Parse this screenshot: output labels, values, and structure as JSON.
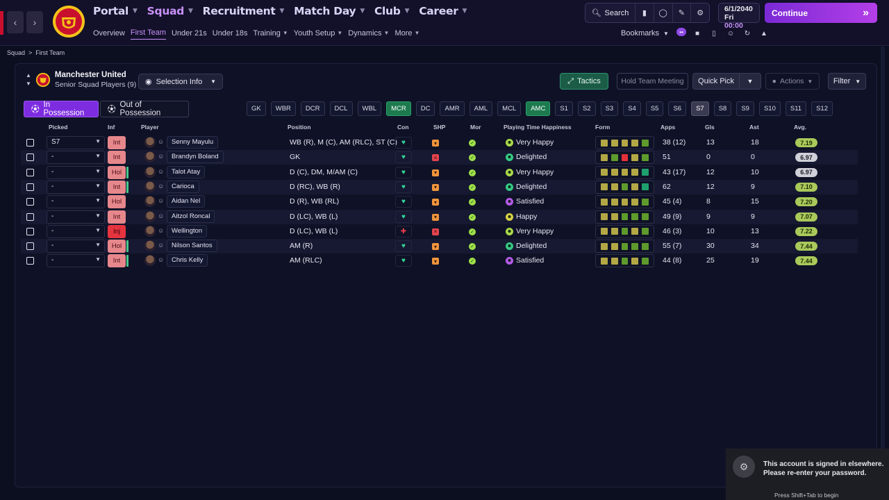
{
  "nav": {
    "back": "‹",
    "forward": "›",
    "main": [
      {
        "label": "Portal",
        "active": false
      },
      {
        "label": "Squad",
        "active": true
      },
      {
        "label": "Recruitment",
        "active": false
      },
      {
        "label": "Match Day",
        "active": false
      },
      {
        "label": "Club",
        "active": false
      },
      {
        "label": "Career",
        "active": false
      }
    ],
    "sub": [
      {
        "label": "Overview",
        "caret": false,
        "active": false
      },
      {
        "label": "First Team",
        "caret": false,
        "active": true
      },
      {
        "label": "Under 21s",
        "caret": false,
        "active": false
      },
      {
        "label": "Under 18s",
        "caret": false,
        "active": false
      },
      {
        "label": "Training",
        "caret": true,
        "active": false
      },
      {
        "label": "Youth Setup",
        "caret": true,
        "active": false
      },
      {
        "label": "Dynamics",
        "caret": true,
        "active": false
      },
      {
        "label": "More",
        "caret": true,
        "active": false
      }
    ],
    "search_label": "Search",
    "date": "6/1/2040",
    "day": "Fri",
    "time": "00:00",
    "continue_label": "Continue",
    "bookmarks_label": "Bookmarks"
  },
  "breadcrumb": {
    "root": "Squad",
    "sep": ">",
    "current": "First Team"
  },
  "team": {
    "name": "Manchester United",
    "subtitle": "Senior Squad Players (9)",
    "selection_info": "Selection Info"
  },
  "toolbar": {
    "tactics": "Tactics",
    "meeting": "Hold Team Meeting",
    "quick_pick": "Quick Pick",
    "actions": "Actions",
    "filter": "Filter"
  },
  "possession": {
    "in": "In Possession",
    "out": "Out of Possession"
  },
  "slots": [
    {
      "label": "GK",
      "state": ""
    },
    {
      "label": "WBR",
      "state": ""
    },
    {
      "label": "DCR",
      "state": ""
    },
    {
      "label": "DCL",
      "state": ""
    },
    {
      "label": "WBL",
      "state": ""
    },
    {
      "label": "MCR",
      "state": "green"
    },
    {
      "label": "DC",
      "state": ""
    },
    {
      "label": "AMR",
      "state": ""
    },
    {
      "label": "AML",
      "state": ""
    },
    {
      "label": "MCL",
      "state": ""
    },
    {
      "label": "AMC",
      "state": "green"
    },
    {
      "label": "S1",
      "state": ""
    },
    {
      "label": "S2",
      "state": ""
    },
    {
      "label": "S3",
      "state": ""
    },
    {
      "label": "S4",
      "state": ""
    },
    {
      "label": "S5",
      "state": ""
    },
    {
      "label": "S6",
      "state": ""
    },
    {
      "label": "S7",
      "state": "sel"
    },
    {
      "label": "S8",
      "state": ""
    },
    {
      "label": "S9",
      "state": ""
    },
    {
      "label": "S10",
      "state": ""
    },
    {
      "label": "S11",
      "state": ""
    },
    {
      "label": "S12",
      "state": ""
    }
  ],
  "columns": {
    "picked": "Picked",
    "inf": "Inf",
    "player": "Player",
    "position": "Position",
    "con": "Con",
    "shp": "SHP",
    "mor": "Mor",
    "happiness": "Playing Time Happiness",
    "form": "Form",
    "apps": "Apps",
    "gls": "Gls",
    "ast": "Ast",
    "avg": "Avg."
  },
  "players": [
    {
      "picked": "S7",
      "inf": "Int",
      "inf_type": "int",
      "inf_bar": false,
      "name": "Senny Mayulu",
      "position": "WB (R), M (C), AM (RLC), ST (C)",
      "con": "good",
      "shp": "ok",
      "happiness": "Very Happy",
      "hap_type": "vh",
      "form": [
        "y",
        "y",
        "y",
        "y",
        "g"
      ],
      "apps": "38 (12)",
      "gls": "13",
      "ast": "18",
      "avg": "7.19",
      "avg_type": "gr"
    },
    {
      "picked": "-",
      "inf": "Int",
      "inf_type": "int",
      "inf_bar": false,
      "name": "Brandyn Boland",
      "position": "GK",
      "con": "good",
      "shp": "bad",
      "happiness": "Delighted",
      "hap_type": "de",
      "form": [
        "y",
        "g",
        "r",
        "y",
        "g"
      ],
      "apps": "51",
      "gls": "0",
      "ast": "0",
      "avg": "6.97",
      "avg_type": "wh"
    },
    {
      "picked": "-",
      "inf": "Hol",
      "inf_type": "int",
      "inf_bar": true,
      "name": "Talot Atay",
      "position": "D (C), DM, M/AM (C)",
      "con": "good",
      "shp": "ok",
      "happiness": "Very Happy",
      "hap_type": "vh",
      "form": [
        "y",
        "y",
        "y",
        "y",
        "t"
      ],
      "apps": "43 (17)",
      "gls": "12",
      "ast": "10",
      "avg": "6.97",
      "avg_type": "wh"
    },
    {
      "picked": "-",
      "inf": "Int",
      "inf_type": "int",
      "inf_bar": true,
      "name": "Carioca",
      "position": "D (RC), WB (R)",
      "con": "good",
      "shp": "ok",
      "happiness": "Delighted",
      "hap_type": "de",
      "form": [
        "y",
        "y",
        "g",
        "y",
        "t"
      ],
      "apps": "62",
      "gls": "12",
      "ast": "9",
      "avg": "7.10",
      "avg_type": "gr"
    },
    {
      "picked": "-",
      "inf": "Hol",
      "inf_type": "int",
      "inf_bar": false,
      "name": "Aidan Nel",
      "position": "D (R), WB (RL)",
      "con": "good",
      "shp": "ok",
      "happiness": "Satisfied",
      "hap_type": "sa",
      "form": [
        "y",
        "y",
        "y",
        "y",
        "g"
      ],
      "apps": "45 (4)",
      "gls": "8",
      "ast": "15",
      "avg": "7.20",
      "avg_type": "gr"
    },
    {
      "picked": "-",
      "inf": "Int",
      "inf_type": "int",
      "inf_bar": false,
      "name": "Aitzol Roncal",
      "position": "D (LC), WB (L)",
      "con": "good",
      "shp": "ok",
      "happiness": "Happy",
      "hap_type": "ha",
      "form": [
        "y",
        "y",
        "g",
        "g",
        "g"
      ],
      "apps": "49 (9)",
      "gls": "9",
      "ast": "9",
      "avg": "7.07",
      "avg_type": "gr"
    },
    {
      "picked": "-",
      "inf": "Inj",
      "inf_type": "inj",
      "inf_bar": false,
      "name": "Wellington",
      "position": "D (LC), WB (L)",
      "con": "bad",
      "shp": "bad",
      "happiness": "Very Happy",
      "hap_type": "vh",
      "form": [
        "y",
        "y",
        "g",
        "y",
        "g"
      ],
      "apps": "46 (3)",
      "gls": "10",
      "ast": "13",
      "avg": "7.22",
      "avg_type": "gr"
    },
    {
      "picked": "-",
      "inf": "Hol",
      "inf_type": "int",
      "inf_bar": true,
      "name": "Nilson Santos",
      "position": "AM (R)",
      "con": "good",
      "shp": "ok",
      "happiness": "Delighted",
      "hap_type": "de",
      "form": [
        "y",
        "y",
        "g",
        "g",
        "g"
      ],
      "apps": "55 (7)",
      "gls": "30",
      "ast": "34",
      "avg": "7.44",
      "avg_type": "gr"
    },
    {
      "picked": "-",
      "inf": "Int",
      "inf_type": "int",
      "inf_bar": true,
      "name": "Chris Kelly",
      "position": "AM (RLC)",
      "con": "good",
      "shp": "ok",
      "happiness": "Satisfied",
      "hap_type": "sa",
      "form": [
        "y",
        "y",
        "g",
        "y",
        "g"
      ],
      "apps": "44 (8)",
      "gls": "25",
      "ast": "19",
      "avg": "7.44",
      "avg_type": "gr"
    }
  ],
  "toast": {
    "line1": "This account is signed in elsewhere.",
    "line2": "Please re-enter your password.",
    "hint": "Press Shift+Tab to begin"
  },
  "colors": {
    "accent": "#7d2ce0",
    "brand_red": "#c8102e",
    "active_nav": "#c792f7",
    "tactics_green": "#1b5c47"
  }
}
